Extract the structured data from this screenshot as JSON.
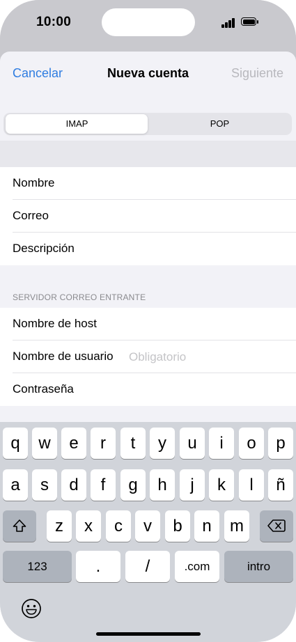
{
  "status": {
    "time": "10:00"
  },
  "nav": {
    "cancel": "Cancelar",
    "title": "Nueva cuenta",
    "next": "Siguiente"
  },
  "segment": {
    "options": [
      "IMAP",
      "POP"
    ],
    "selected": "IMAP"
  },
  "account": {
    "name_label": "Nombre",
    "email_label": "Correo",
    "description_label": "Descripción"
  },
  "incoming": {
    "header": "SERVIDOR CORREO ENTRANTE",
    "host_label": "Nombre de host",
    "username_label": "Nombre de usuario",
    "username_placeholder": "Obligatorio",
    "password_label": "Contraseña"
  },
  "keyboard": {
    "row1": [
      "q",
      "w",
      "e",
      "r",
      "t",
      "y",
      "u",
      "i",
      "o",
      "p"
    ],
    "row2": [
      "a",
      "s",
      "d",
      "f",
      "g",
      "h",
      "j",
      "k",
      "l",
      "ñ"
    ],
    "row3": [
      "z",
      "x",
      "c",
      "v",
      "b",
      "n",
      "m"
    ],
    "row4": {
      "numbers": "123",
      "dot": ".",
      "slash": "/",
      "dotcom": ".com",
      "enter": "intro"
    }
  },
  "colors": {
    "accent": "#2f7de1",
    "disabled": "#b8b8bd",
    "keyboard_bg": "#d1d4da"
  },
  "icons": [
    "shift-icon",
    "backspace-icon",
    "emoji-icon",
    "signal-icon",
    "battery-icon"
  ]
}
